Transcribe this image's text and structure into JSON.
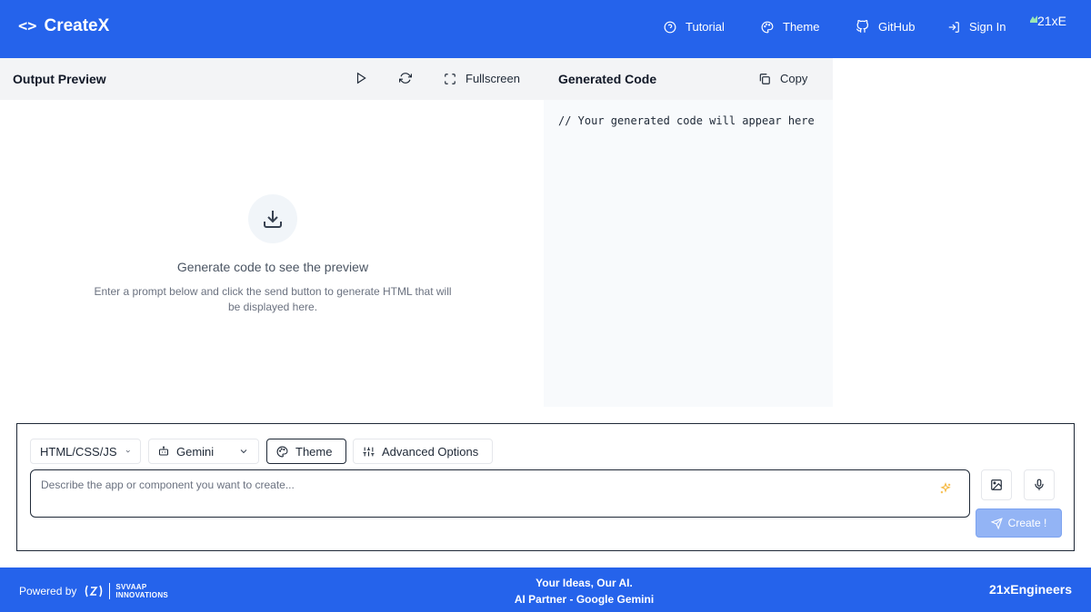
{
  "header": {
    "brand": "CreateX",
    "brand_icon": "code-icon",
    "nav": {
      "tutorial": "Tutorial",
      "theme": "Theme",
      "github": "GitHub",
      "sign_in": "Sign In"
    },
    "avatar_alt": "21xE"
  },
  "preview": {
    "title": "Output Preview",
    "fullscreen_label": "Fullscreen",
    "empty_title": "Generate code to see the preview",
    "empty_desc": "Enter a prompt below and click the send button to generate HTML that will be displayed here."
  },
  "code": {
    "title": "Generated Code",
    "copy_label": "Copy",
    "placeholder_text": "// Your generated code will appear here"
  },
  "prompt": {
    "language": "HTML/CSS/JS",
    "model": "Gemini",
    "theme_label": "Theme",
    "advanced_label": "Advanced Options",
    "placeholder": "Describe the app or component you want to create...",
    "create_label": "Create !"
  },
  "footer": {
    "powered_by": "Powered by",
    "sponsor_name_line1": "SVVAAP",
    "sponsor_name_line2": "INNOVATIONS",
    "tagline_line1": "Your Ideas, Our AI.",
    "tagline_line2": "AI Partner - Google Gemini",
    "brand_right": "21xEngineers"
  },
  "colors": {
    "primary": "#2563eb",
    "create_disabled": "#93b4f5",
    "sparkle": "#f5b942"
  }
}
